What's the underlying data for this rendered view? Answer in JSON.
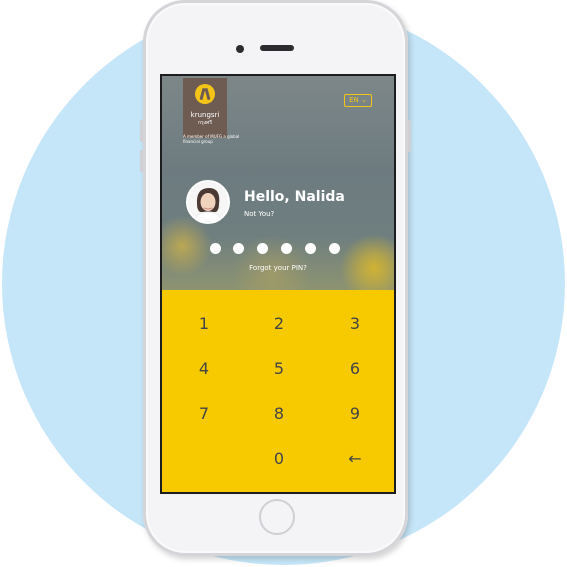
{
  "bank": {
    "name": "krungsri",
    "name_thai": "กรุงศรี",
    "member_text": "A member of MUFG a global financial group"
  },
  "language": {
    "selected": "EN",
    "chevron": "chevron-down-icon"
  },
  "user": {
    "greeting": "Hello, Nalida",
    "not_you": "Not You?"
  },
  "pin": {
    "digits_total": 6,
    "forgot": "Forgot your PIN?"
  },
  "keypad": {
    "keys": [
      "1",
      "2",
      "3",
      "4",
      "5",
      "6",
      "7",
      "8",
      "9",
      "",
      "0",
      "←"
    ],
    "backspace_icon": "backspace-arrow-icon"
  },
  "colors": {
    "accent": "#f7ca00",
    "background_circle": "#c5e6f8",
    "logo_bg": "#6e5b52"
  }
}
